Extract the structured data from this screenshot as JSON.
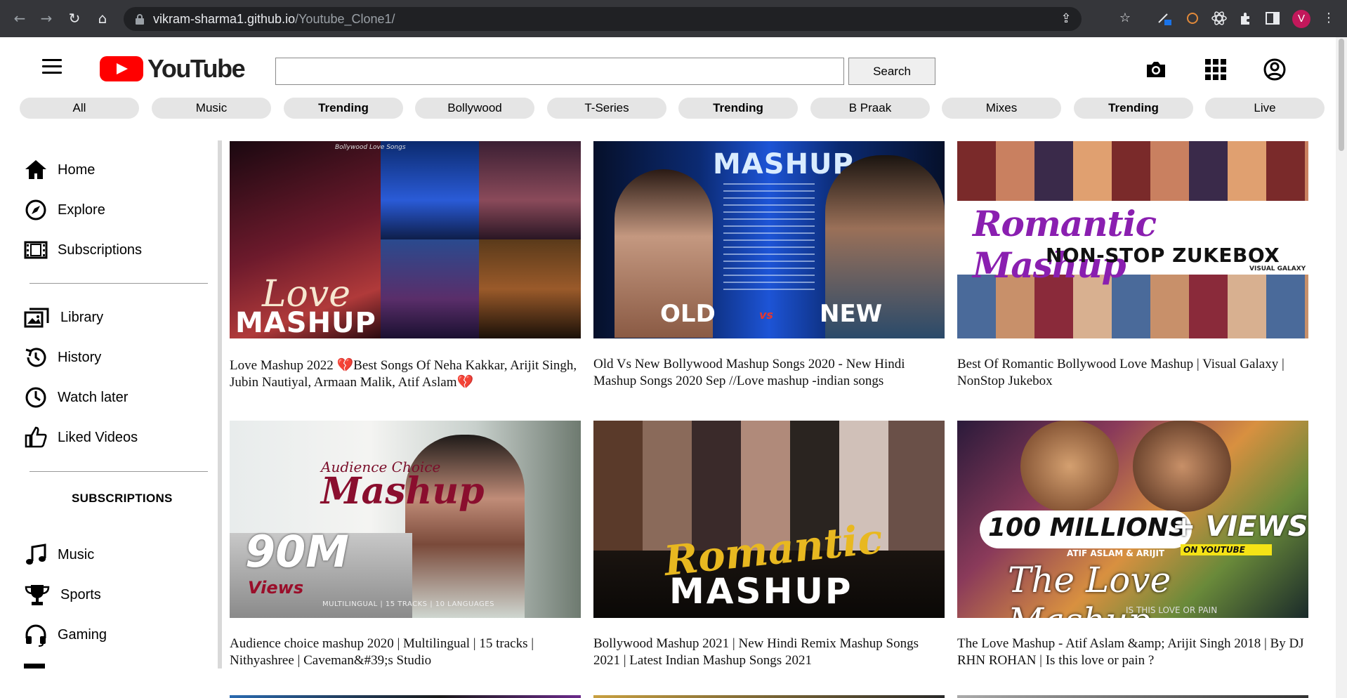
{
  "browser": {
    "url_host": "vikram-sharma1.github.io",
    "url_path": "/Youtube_Clone1/",
    "profile_initial": "V"
  },
  "header": {
    "logo_text": "YouTube",
    "search_placeholder": "",
    "search_button": "Search"
  },
  "chips": [
    {
      "label": "All",
      "bold": false
    },
    {
      "label": "Music",
      "bold": false
    },
    {
      "label": "Trending",
      "bold": true
    },
    {
      "label": "Bollywood",
      "bold": false
    },
    {
      "label": "T-Series",
      "bold": false
    },
    {
      "label": "Trending",
      "bold": true
    },
    {
      "label": "B Praak",
      "bold": false
    },
    {
      "label": "Mixes",
      "bold": false
    },
    {
      "label": "Trending",
      "bold": true
    },
    {
      "label": "Live",
      "bold": false
    }
  ],
  "sidebar": {
    "items": [
      {
        "label": "Home",
        "icon": "home-icon"
      },
      {
        "label": "Explore",
        "icon": "compass-icon"
      },
      {
        "label": "Subscriptions",
        "icon": "subscriptions-icon"
      },
      {
        "label": "Library",
        "icon": "library-icon"
      },
      {
        "label": "History",
        "icon": "history-icon"
      },
      {
        "label": "Watch later",
        "icon": "clock-icon"
      },
      {
        "label": "Liked Videos",
        "icon": "thumbs-up-icon"
      }
    ],
    "subscriptions_heading": "SUBSCRIPTIONS",
    "subscriptions": [
      {
        "label": "Music",
        "icon": "music-note-icon"
      },
      {
        "label": "Sports",
        "icon": "trophy-icon"
      },
      {
        "label": "Gaming",
        "icon": "headset-icon"
      }
    ]
  },
  "videos": [
    {
      "title": "Love Mashup 2022 💔Best Songs Of Neha Kakkar, Arijit Singh, Jubin Nautiyal, Armaan Malik, Atif Aslam💔",
      "thumb_text_1": "Love",
      "thumb_text_2": "MASHUP",
      "thumb_text_3": "Bollywood Love Songs"
    },
    {
      "title": "Old Vs New Bollywood Mashup Songs 2020 - New Hindi Mashup Songs 2020 Sep //Love mashup -indian songs",
      "thumb_text_1": "MASHUP",
      "thumb_text_2": "OLD",
      "thumb_text_3": "NEW",
      "thumb_text_4": "vs"
    },
    {
      "title": "Best Of Romantic Bollywood Love Mashup | Visual Galaxy | NonStop Jukebox",
      "thumb_text_1": "Romantic Mashup",
      "thumb_text_2": "NON-STOP ZUKEBOX",
      "thumb_text_3": "VISUAL GALAXY"
    },
    {
      "title": "Audience choice mashup 2020 | Multilingual | 15 tracks | Nithyashree | Caveman&#39;s Studio",
      "thumb_text_1": "Audience Choice",
      "thumb_text_2": "Mashup",
      "thumb_text_3": "90M",
      "thumb_text_4": "Views",
      "thumb_text_5": "MULTILINGUAL | 15 TRACKS | 10 LANGUAGES"
    },
    {
      "title": "Bollywood Mashup 2021 | New Hindi Remix Mashup Songs 2021 | Latest Indian Mashup Songs 2021",
      "thumb_text_1": "Romantic",
      "thumb_text_2": "MASHUP"
    },
    {
      "title": "The Love Mashup - Atif Aslam &amp; Arijit Singh 2018 | By DJ RHN ROHAN | Is this love or pain ?",
      "thumb_text_1": "100 MILLIONS",
      "thumb_text_2": "+ VIEWS",
      "thumb_text_3": "ON YOUTUBE",
      "thumb_text_4": "ATIF ASLAM & ARIJIT",
      "thumb_text_5": "The Love Mashup",
      "thumb_text_6": "IS THIS LOVE OR PAIN"
    }
  ]
}
